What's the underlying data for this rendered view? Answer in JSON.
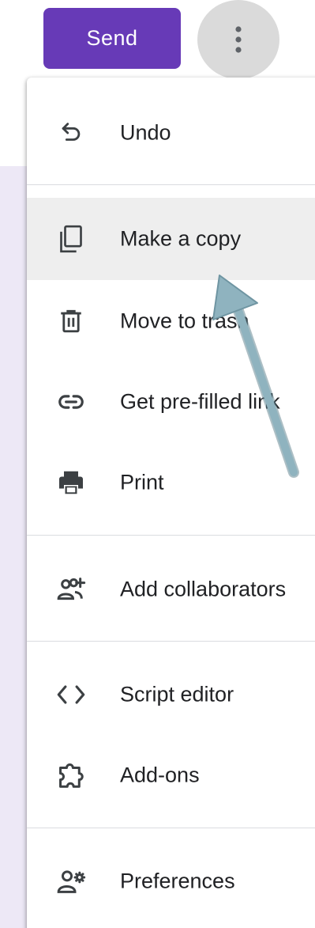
{
  "toolbar": {
    "send_label": "Send",
    "more_icon": "more-vert-icon"
  },
  "menu": {
    "items": [
      {
        "label": "Undo",
        "icon": "undo-icon"
      },
      {
        "label": "Make a copy",
        "icon": "copy-icon",
        "highlighted": true
      },
      {
        "label": "Move to trash",
        "icon": "trash-icon"
      },
      {
        "label": "Get pre-filled link",
        "icon": "link-icon"
      },
      {
        "label": "Print",
        "icon": "print-icon"
      },
      {
        "label": "Add collaborators",
        "icon": "add-people-icon"
      },
      {
        "label": "Script editor",
        "icon": "code-icon"
      },
      {
        "label": "Add-ons",
        "icon": "puzzle-icon"
      },
      {
        "label": "Preferences",
        "icon": "person-settings-icon"
      }
    ]
  },
  "colors": {
    "accent": "#673ab7",
    "highlight": "#eeeeee",
    "arrow": "#8fb3bf",
    "icon": "#5f6368"
  }
}
